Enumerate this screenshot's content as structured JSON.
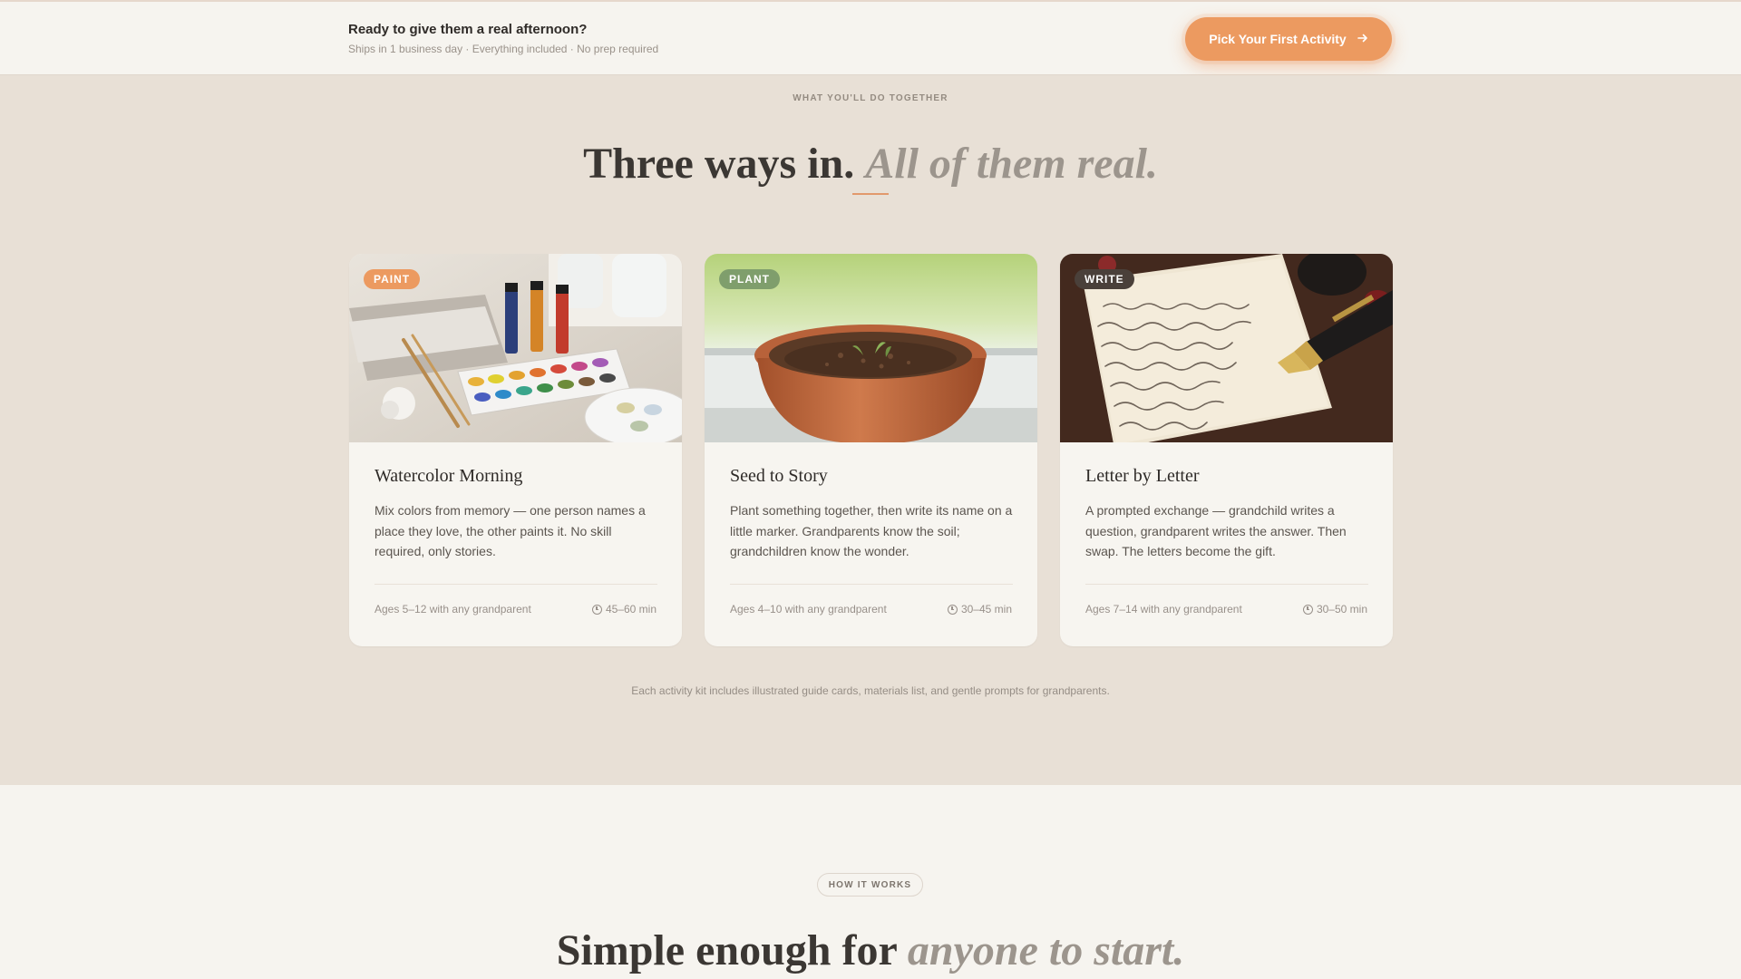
{
  "topbar": {
    "headline": "Ready to give them a real afternoon?",
    "subline": "Ships in 1 business day · Everything included · No prep required",
    "cta_label": "Pick Your First Activity",
    "cta_icon": "arrow-right-icon",
    "accent": "#ec9a60"
  },
  "activities": {
    "eyebrow": "WHAT YOU'LL DO TOGETHER",
    "title_main": "Three ways in.",
    "title_emph": "All of them real.",
    "cards": [
      {
        "badge": "PAINT",
        "badge_color": "#ec9a60",
        "title": "Watercolor Morning",
        "description": "Mix colors from memory — one person names a place they love, the other paints it. No skill required, only stories.",
        "ages": "Ages 5–12 with any grandparent",
        "duration": "45–60 min"
      },
      {
        "badge": "PLANT",
        "badge_color": "#7f9e6c",
        "title": "Seed to Story",
        "description": "Plant something together, then write its name on a little marker. Grandparents know the soil; grandchildren know the wonder.",
        "ages": "Ages 4–10 with any grandparent",
        "duration": "30–45 min"
      },
      {
        "badge": "WRITE",
        "badge_color": "#4a403a",
        "title": "Letter by Letter",
        "description": "A prompted exchange — grandchild writes a question, grandparent writes the answer. Then swap. The letters become the gift.",
        "ages": "Ages 7–14 with any grandparent",
        "duration": "30–50 min"
      }
    ],
    "footnote": "Each activity kit includes illustrated guide cards, materials list, and gentle prompts for grandparents."
  },
  "how": {
    "pill": "HOW IT WORKS",
    "title_main": "Simple enough for",
    "title_emph": "anyone to start."
  }
}
